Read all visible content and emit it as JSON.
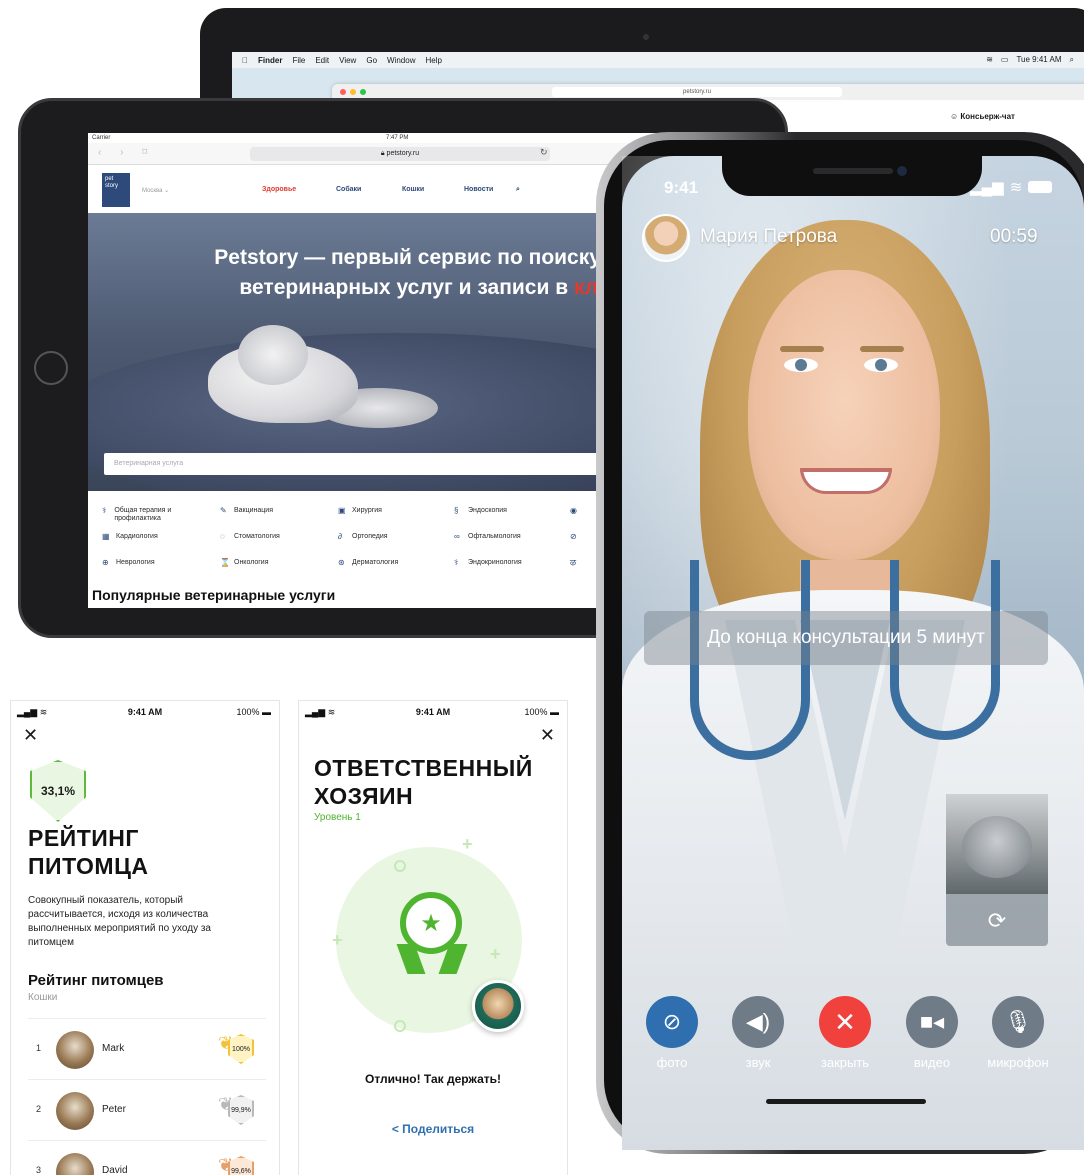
{
  "laptop": {
    "menubar": {
      "apple_icon": "apple-icon",
      "app": "Finder",
      "menus": [
        "File",
        "Edit",
        "View",
        "Go",
        "Window",
        "Help"
      ],
      "clock": "Tue 9:41 AM"
    },
    "url": "petstory.ru",
    "side_label": "Консьерж-чат"
  },
  "ipad": {
    "status": {
      "carrier": "Carrier",
      "time": "7:47 PM"
    },
    "url": "petstory.ru",
    "city": "Москва",
    "logo_text": "pet story",
    "nav": [
      "Здоровье",
      "Собаки",
      "Кошки",
      "Новости"
    ],
    "hero_line1": "Petstory — первый сервис по поиску и сра",
    "hero_line2_a": "ветеринарных услуг и записи в ",
    "hero_line2_b": "клини",
    "search_placeholder": "Ветеринарная услуга",
    "categories": [
      "Общая терапия и профилактика",
      "Вакцинация",
      "Хирургия",
      "Эндоскопия",
      "Кардиология",
      "Стоматология",
      "Ортопедия",
      "Офтальмология",
      "Неврология",
      "Онкология",
      "Дерматология",
      "Эндокринология"
    ],
    "popular_heading": "Популярные ветеринарные услуги"
  },
  "call": {
    "time": "9:41",
    "caller_name": "Мария Петрова",
    "timer": "00:59",
    "notice": "До конца консультации 5 минут",
    "buttons": [
      {
        "label": "фото",
        "icon": "paperclip-icon",
        "color": "#2f6fb0"
      },
      {
        "label": "звук",
        "icon": "speaker-icon",
        "color": "#6f7b86"
      },
      {
        "label": "закрыть",
        "icon": "close-icon",
        "color": "#f0413d"
      },
      {
        "label": "видео",
        "icon": "video-icon",
        "color": "#6f7b86"
      },
      {
        "label": "микрофон",
        "icon": "mic-icon",
        "color": "#6f7b86"
      }
    ]
  },
  "rating_screen": {
    "status": {
      "time": "9:41 AM",
      "battery": "100%"
    },
    "score": "33,1%",
    "title": "РЕЙТИНГ ПИТОМЦА",
    "description": "Совокупный показатель, который рассчитывается, исходя из количества выполненных мероприятий по уходу за питомцем",
    "list_title": "Рейтинг питомцев",
    "list_subtitle": "Кошки",
    "rows": [
      {
        "rank": "1",
        "name": "Mark",
        "value": "100%",
        "color": "#f2c23b"
      },
      {
        "rank": "2",
        "name": "Peter",
        "value": "99,9%",
        "color": "#b9b9b9"
      },
      {
        "rank": "3",
        "name": "David",
        "value": "99,6%",
        "color": "#e6a06a"
      }
    ]
  },
  "owner_screen": {
    "status": {
      "time": "9:41 AM",
      "battery": "100%"
    },
    "title": "ОТВЕТСТВЕННЫЙ ХОЗЯИН",
    "level": "Уровень 1",
    "message": "Отлично! Так держать!",
    "share": "Поделиться"
  },
  "colors": {
    "accent_green": "#4fb531",
    "brand_blue": "#2d4a7a",
    "accent_red": "#e03a2f"
  }
}
